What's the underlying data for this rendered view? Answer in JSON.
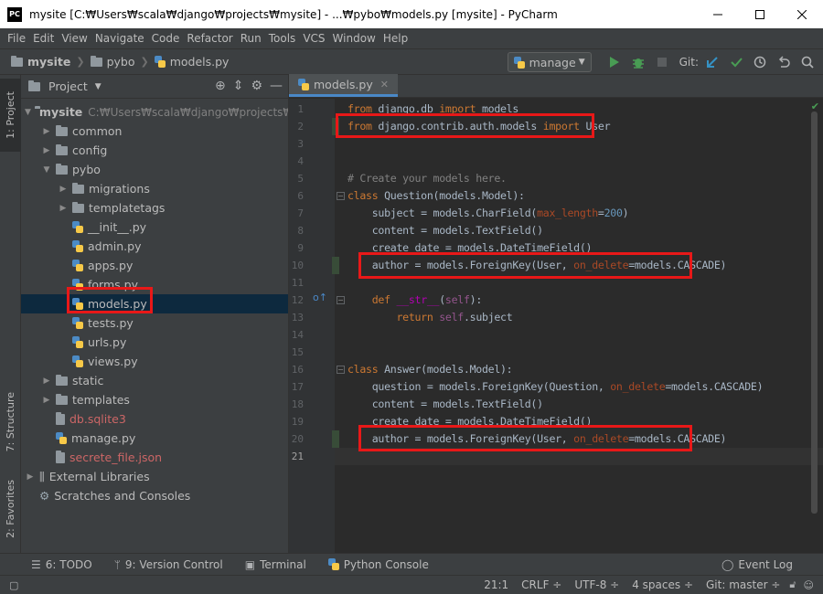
{
  "window": {
    "title": "mysite [C:₩Users₩scala₩django₩projects₩mysite] - ...₩pybo₩models.py [mysite] - PyCharm",
    "app_badge": "PC"
  },
  "menu": [
    "File",
    "Edit",
    "View",
    "Navigate",
    "Code",
    "Refactor",
    "Run",
    "Tools",
    "VCS",
    "Window",
    "Help"
  ],
  "breadcrumb": [
    "mysite",
    "pybo",
    "models.py"
  ],
  "toolbar": {
    "run_config": "manage",
    "git_label": "Git:"
  },
  "left_tools": {
    "project": "1: Project",
    "structure": "7: Structure",
    "favorites": "2: Favorites"
  },
  "project_panel": {
    "title": "Project",
    "tree": [
      {
        "label": "mysite",
        "path": "C:₩Users₩scala₩django₩projects₩mysite",
        "type": "folder",
        "expanded": true
      },
      {
        "label": "common",
        "type": "folder"
      },
      {
        "label": "config",
        "type": "folder"
      },
      {
        "label": "pybo",
        "type": "folder",
        "expanded": true
      },
      {
        "label": "migrations",
        "type": "folder"
      },
      {
        "label": "templatetags",
        "type": "folder"
      },
      {
        "label": "__init__.py",
        "type": "py"
      },
      {
        "label": "admin.py",
        "type": "py"
      },
      {
        "label": "apps.py",
        "type": "py"
      },
      {
        "label": "forms.py",
        "type": "py"
      },
      {
        "label": "models.py",
        "type": "py",
        "selected": true
      },
      {
        "label": "tests.py",
        "type": "py"
      },
      {
        "label": "urls.py",
        "type": "py"
      },
      {
        "label": "views.py",
        "type": "py"
      },
      {
        "label": "static",
        "type": "folder"
      },
      {
        "label": "templates",
        "type": "folder"
      },
      {
        "label": "db.sqlite3",
        "type": "db",
        "red": true
      },
      {
        "label": "manage.py",
        "type": "py"
      },
      {
        "label": "secrete_file.json",
        "type": "json",
        "red": true
      },
      {
        "label": "External Libraries",
        "type": "lib"
      },
      {
        "label": "Scratches and Consoles",
        "type": "scratch"
      }
    ]
  },
  "editor": {
    "tab": "models.py",
    "current_line": 21,
    "lines": [
      [
        [
          "kw",
          "from"
        ],
        [
          "t",
          " django.db "
        ],
        [
          "kw",
          "import"
        ],
        [
          "t",
          " models"
        ]
      ],
      [
        [
          "kw",
          "from"
        ],
        [
          "t",
          " django.contrib.auth.models "
        ],
        [
          "kw",
          "import"
        ],
        [
          "t",
          " User"
        ]
      ],
      [],
      [],
      [
        [
          "cm",
          "# Create your models here."
        ]
      ],
      [
        [
          "kw",
          "class"
        ],
        [
          "t",
          " Question(models.Model):"
        ]
      ],
      [
        [
          "t",
          "    subject = models.CharField("
        ],
        [
          "par",
          "max_length"
        ],
        [
          "t",
          "="
        ],
        [
          "num",
          "200"
        ],
        [
          "t",
          ")"
        ]
      ],
      [
        [
          "t",
          "    content = models.TextField()"
        ]
      ],
      [
        [
          "t",
          "    create_date = models.DateTimeField()"
        ]
      ],
      [
        [
          "t",
          "    author = models.ForeignKey(User, "
        ],
        [
          "par",
          "on_delete"
        ],
        [
          "t",
          "=models.CASCADE)"
        ]
      ],
      [],
      [
        [
          "t",
          "    "
        ],
        [
          "kw",
          "def"
        ],
        [
          "t",
          " "
        ],
        [
          "mg",
          "__str__"
        ],
        [
          "t",
          "("
        ],
        [
          "slf",
          "self"
        ],
        [
          "t",
          "):"
        ]
      ],
      [
        [
          "t",
          "        "
        ],
        [
          "kw",
          "return"
        ],
        [
          "t",
          " "
        ],
        [
          "slf",
          "self"
        ],
        [
          "t",
          ".subject"
        ]
      ],
      [],
      [],
      [
        [
          "kw",
          "class"
        ],
        [
          "t",
          " Answer(models.Model):"
        ]
      ],
      [
        [
          "t",
          "    question = models.ForeignKey(Question, "
        ],
        [
          "par",
          "on_delete"
        ],
        [
          "t",
          "=models.CASCADE)"
        ]
      ],
      [
        [
          "t",
          "    content = models.TextField()"
        ]
      ],
      [
        [
          "t",
          "    create_date = models.DateTimeField()"
        ]
      ],
      [
        [
          "t",
          "    author = models.ForeignKey(User, "
        ],
        [
          "par",
          "on_delete"
        ],
        [
          "t",
          "=models.CASCADE)"
        ]
      ],
      []
    ]
  },
  "bottom_tools": [
    "6: TODO",
    "9: Version Control",
    "Terminal",
    "Python Console"
  ],
  "event_log": "Event Log",
  "status": {
    "position": "21:1",
    "line_sep": "CRLF ÷",
    "encoding": "UTF-8 ÷",
    "indent": "4 spaces ÷",
    "git": "Git: master ÷"
  },
  "colors": {
    "highlight": "#e81818",
    "selection": "#0d293e",
    "accent": "#4a88c7"
  }
}
